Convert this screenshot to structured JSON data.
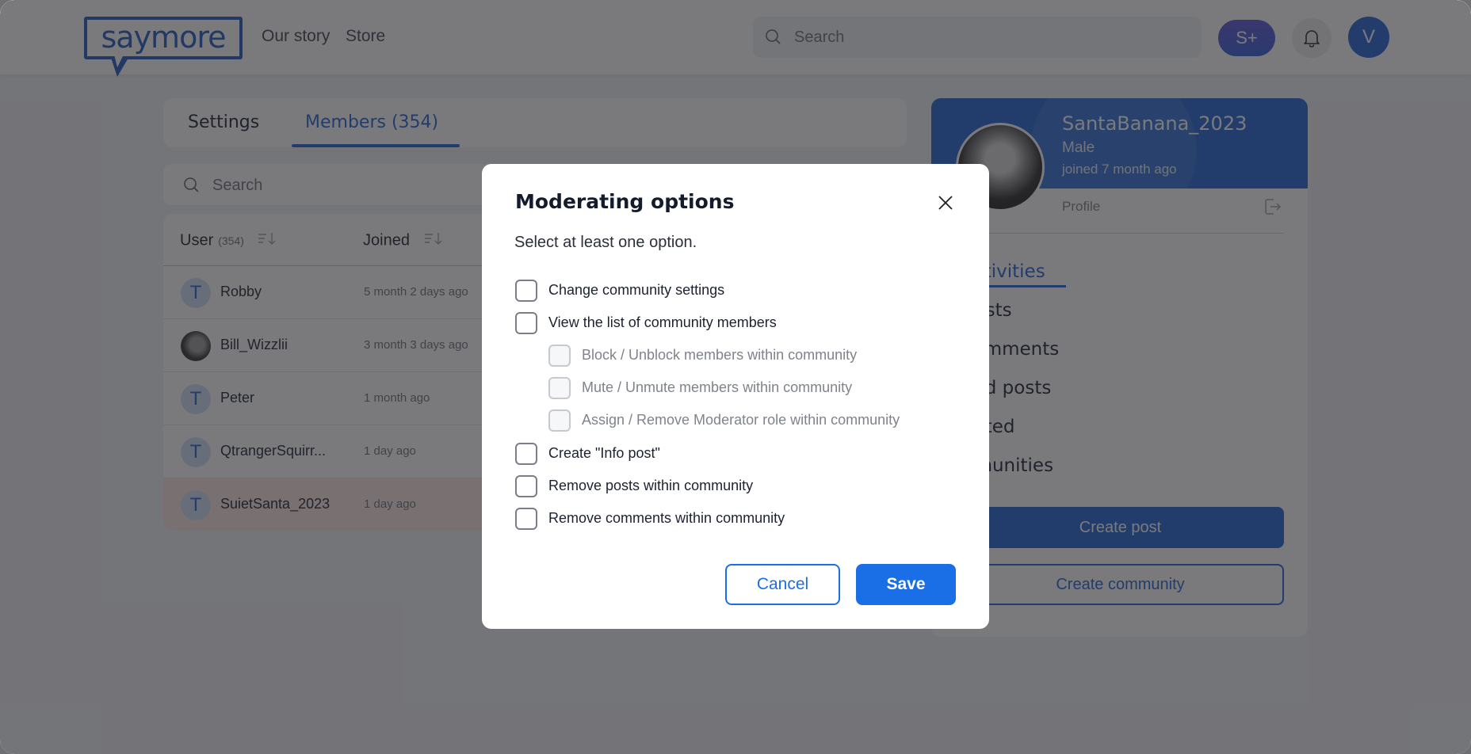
{
  "header": {
    "logo_text": "saymore",
    "nav": [
      {
        "label": "Our story"
      },
      {
        "label": "Store"
      }
    ],
    "search_placeholder": "Search",
    "premium_badge": "S+",
    "avatar_initial": "V"
  },
  "tabs": [
    {
      "label": "Settings",
      "active": false
    },
    {
      "label": "Members (354)",
      "active": true
    }
  ],
  "members": {
    "search_placeholder": "Search",
    "columns": {
      "user": "User",
      "user_count": "(354)",
      "joined": "Joined"
    },
    "rows": [
      {
        "initial": "T",
        "name": "Robby",
        "joined": "5 month 2 days ago",
        "photo": false,
        "highlighted": false
      },
      {
        "initial": "",
        "name": "Bill_Wizzlii",
        "joined": "3 month 3 days ago",
        "photo": true,
        "highlighted": false
      },
      {
        "initial": "T",
        "name": "Peter",
        "joined": "1 month ago",
        "photo": false,
        "highlighted": false
      },
      {
        "initial": "T",
        "name": "QtrangerSquirr...",
        "joined": "1 day ago",
        "photo": false,
        "highlighted": false
      },
      {
        "initial": "T",
        "name": "SuietSanta_2023",
        "joined": "1 day ago",
        "photo": false,
        "highlighted": true
      }
    ]
  },
  "profile": {
    "username": "SantaBanana_2023",
    "gender": "Male",
    "joined": "joined 7 month ago",
    "profile_link": "Profile",
    "menu": [
      {
        "label": "activities",
        "active": true
      },
      {
        "label": "posts",
        "active": false
      },
      {
        "label": "comments",
        "active": false
      },
      {
        "label": "ved posts",
        "active": false
      },
      {
        "label": "voted",
        "active": false
      },
      {
        "label": "nmunities",
        "active": false
      }
    ],
    "create_post_label": "Create post",
    "create_community_label": "Create community"
  },
  "modal": {
    "title": "Moderating options",
    "subtitle": "Select at least one option.",
    "options": [
      {
        "label": "Change community settings",
        "checked": false,
        "sub": false
      },
      {
        "label": "View the list of community members",
        "checked": false,
        "sub": false
      },
      {
        "label": "Block / Unblock members within community",
        "checked": false,
        "sub": true,
        "disabled": true
      },
      {
        "label": "Mute / Unmute members within community",
        "checked": false,
        "sub": true,
        "disabled": true
      },
      {
        "label": "Assign / Remove Moderator role within community",
        "checked": false,
        "sub": true,
        "disabled": true
      },
      {
        "label": "Create \"Info post\"",
        "checked": false,
        "sub": false
      },
      {
        "label": "Remove posts within community",
        "checked": false,
        "sub": false
      },
      {
        "label": "Remove comments within community",
        "checked": false,
        "sub": false
      }
    ],
    "cancel_label": "Cancel",
    "save_label": "Save"
  },
  "colors": {
    "accent": "#1a5ed6",
    "button_primary": "#1a6fe6",
    "highlight_row": "#fbe4e4"
  }
}
